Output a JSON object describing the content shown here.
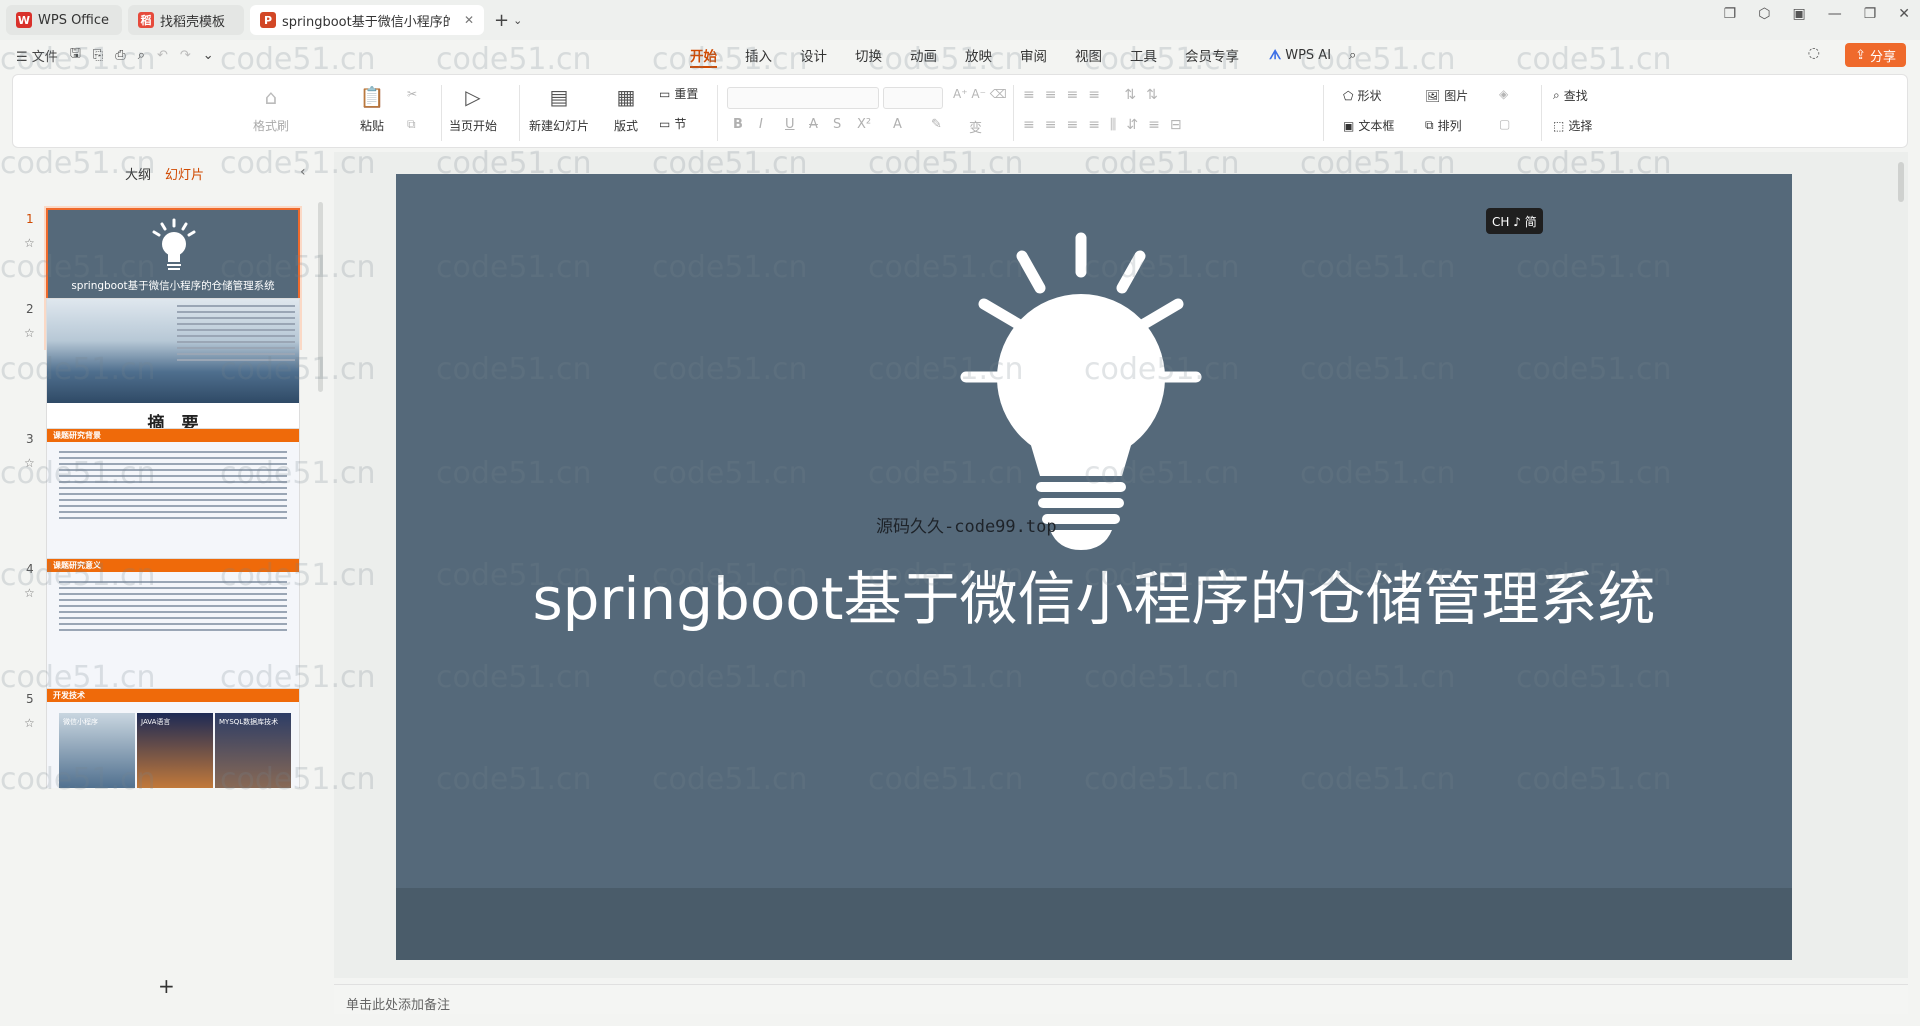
{
  "tabs": [
    {
      "label": "WPS Office",
      "glyph": "W",
      "color": "#d9312b"
    },
    {
      "label": "找稻壳模板",
      "glyph": "稻",
      "color": "#e64a3b"
    },
    {
      "label": "springboot基于微信小程序的",
      "glyph": "P",
      "color": "#d24726",
      "active": true
    }
  ],
  "menu": {
    "file": "文件",
    "tabs": [
      "开始",
      "插入",
      "设计",
      "切换",
      "动画",
      "放映",
      "审阅",
      "视图",
      "工具",
      "会员专享"
    ],
    "active_tab": "开始",
    "wps_ai": "WPS AI",
    "share": "分享"
  },
  "ribbon": {
    "format_brush": "格式刷",
    "paste": "粘贴",
    "play_from_current": "当页开始",
    "new_slide": "新建幻灯片",
    "layout": "版式",
    "section": "节",
    "reset": "重置",
    "shape": "形状",
    "picture": "图片",
    "textbox": "文本框",
    "arrange": "排列",
    "find": "查找",
    "select": "选择"
  },
  "panel": {
    "tab_outline": "大纲",
    "tab_slides": "幻灯片"
  },
  "thumbnails": {
    "s1_title": "springboot基于微信小程序的仓储管理系统",
    "s2_heading": "摘　要",
    "s3_bar": "课题研究背景",
    "s4_bar": "课题研究意义",
    "s5_bar": "开发技术",
    "s5_cells": [
      "微信小程序",
      "JAVA语言",
      "MYSQL数据库技术"
    ],
    "numbers": [
      "1",
      "2",
      "3",
      "4",
      "5"
    ]
  },
  "slide": {
    "title": "springboot基于微信小程序的仓储管理系统",
    "overlay_text": "源码久久-code99.top"
  },
  "ime_badge": "CH ♪ 简",
  "notes_placeholder": "单击此处添加备注",
  "watermark": "code51.cn",
  "colors": {
    "accent": "#d04a02",
    "slide_bg": "#55697a",
    "share": "#ef6a2c"
  }
}
